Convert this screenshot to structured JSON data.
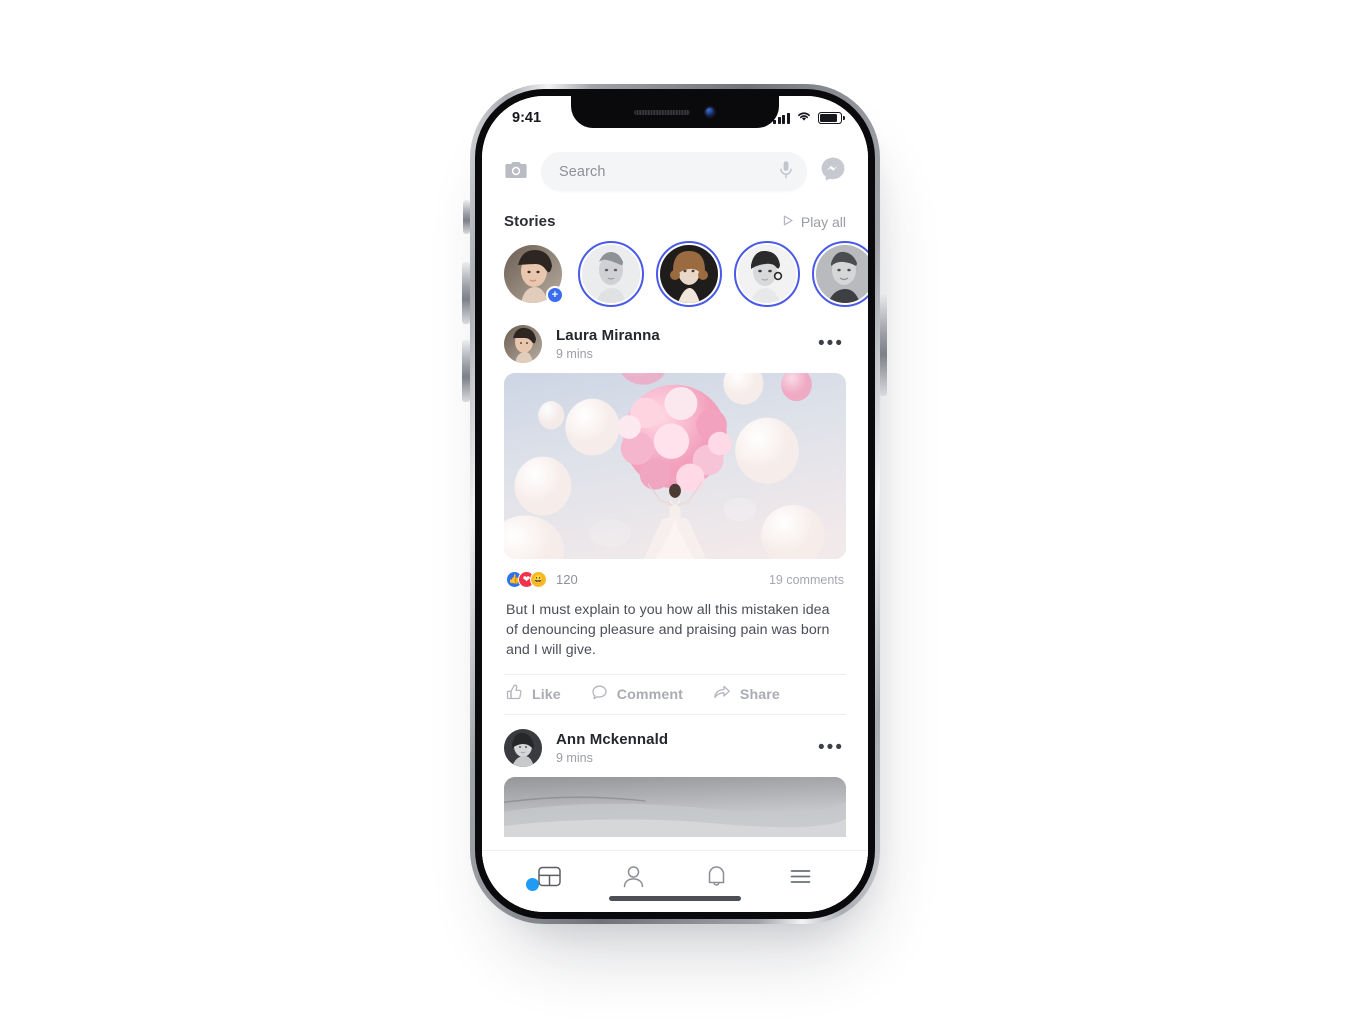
{
  "status_bar": {
    "time": "9:41",
    "signal_icon": "cellular-signal-icon",
    "wifi_icon": "wifi-icon",
    "battery_icon": "battery-icon"
  },
  "search": {
    "camera_icon": "camera-icon",
    "placeholder": "Search",
    "mic_icon": "microphone-icon",
    "messenger_icon": "messenger-icon"
  },
  "stories": {
    "title": "Stories",
    "play_all_label": "Play all",
    "play_icon": "play-triangle-icon",
    "add_badge": "+",
    "items": [
      {
        "name": "your-story",
        "has_ring": false,
        "has_add": true
      },
      {
        "name": "story-2",
        "has_ring": true,
        "has_add": false
      },
      {
        "name": "story-3",
        "has_ring": true,
        "has_add": false
      },
      {
        "name": "story-4",
        "has_ring": true,
        "has_add": false
      },
      {
        "name": "story-5",
        "has_ring": true,
        "has_add": false
      }
    ]
  },
  "posts": [
    {
      "author": "Laura Miranna",
      "time": "9 mins",
      "more_icon": "ellipsis-icon",
      "media": "balloons-photo",
      "reactions": {
        "like_icon": "thumbs-up-reaction",
        "love_icon": "heart-reaction",
        "haha_icon": "smiley-reaction",
        "count": "120",
        "comments": "19 comments"
      },
      "text": "But I must explain to you how all this mistaken idea of denouncing pleasure and praising pain was born and I will give.",
      "actions": [
        {
          "label": "Like",
          "icon": "thumbs-up-icon"
        },
        {
          "label": "Comment",
          "icon": "comment-bubble-icon"
        },
        {
          "label": "Share",
          "icon": "share-arrow-icon"
        }
      ]
    },
    {
      "author": "Ann Mckennald",
      "time": "9 mins",
      "more_icon": "ellipsis-icon",
      "media": "landscape-photo"
    }
  ],
  "bottom_nav": [
    {
      "name": "feed",
      "icon": "feed-layout-icon",
      "active": true
    },
    {
      "name": "profile",
      "icon": "person-icon",
      "active": false
    },
    {
      "name": "notifications",
      "icon": "bell-icon",
      "active": false
    },
    {
      "name": "menu",
      "icon": "hamburger-menu-icon",
      "active": false
    }
  ],
  "colors": {
    "story_ring": "#4a5ae8",
    "add_badge": "#3a6df0",
    "nav_dot": "#1e9bf5",
    "reaction_like": "#2e72ef",
    "reaction_love": "#f0324b",
    "reaction_haha": "#f7b928"
  }
}
